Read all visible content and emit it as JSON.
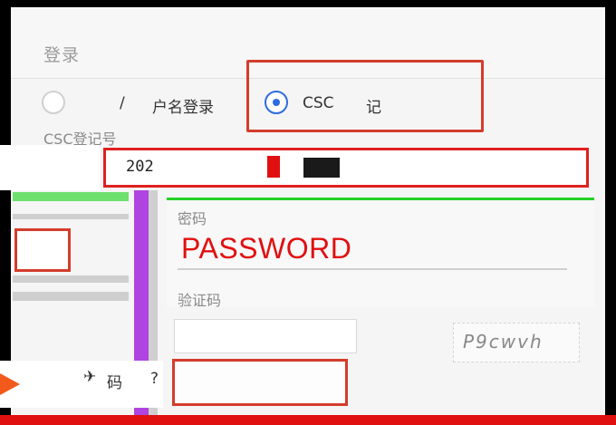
{
  "login_card": {
    "title": "登录"
  },
  "login_method": {
    "option_username_prefix": "/",
    "option_username_label": "户名登录",
    "option_csc_label": "CSC",
    "option_csc_suffix": "记",
    "selected": "CSC"
  },
  "fields": {
    "csc_reg_label": "CSC登记号",
    "csc_reg_value": "202",
    "password_label": "密码",
    "password_placeholder": "PASSWORD",
    "captcha_label": "验证码",
    "captcha_image_text": "P9cwvh"
  },
  "footer": {
    "forgot_prefix": "码",
    "forgot_question": "?"
  },
  "colors": {
    "radio_selected": "#2d6cdf",
    "highlight_red": "#d43c2c",
    "password_red": "#e01010"
  }
}
